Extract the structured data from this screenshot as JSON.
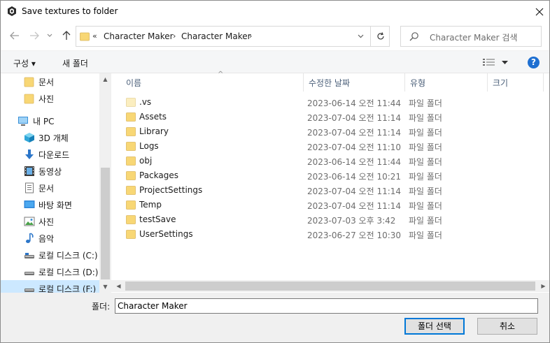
{
  "window": {
    "title": "Save textures to folder",
    "close_label": "✕"
  },
  "nav": {
    "back_label": "←",
    "forward_label": "→",
    "recent_label": "⌄",
    "up_label": "↑"
  },
  "address": {
    "overflow": "«",
    "parts": [
      "Character Maker",
      "Character Maker"
    ],
    "separator": "›"
  },
  "search": {
    "placeholder": "Character Maker 검색"
  },
  "toolbar": {
    "organize_label": "구성 ▾",
    "new_folder_label": "새 폴더",
    "help_label": "?"
  },
  "sidebar": {
    "items": [
      {
        "label": "문서",
        "icon": "folder-icon"
      },
      {
        "label": "사진",
        "icon": "folder-icon"
      },
      {
        "label": "내 PC",
        "icon": "computer-icon"
      },
      {
        "label": "3D 개체",
        "icon": "cube-icon"
      },
      {
        "label": "다운로드",
        "icon": "download-icon"
      },
      {
        "label": "동영상",
        "icon": "video-icon"
      },
      {
        "label": "문서",
        "icon": "document-icon"
      },
      {
        "label": "바탕 화면",
        "icon": "desktop-icon"
      },
      {
        "label": "사진",
        "icon": "pictures-icon"
      },
      {
        "label": "음악",
        "icon": "music-icon"
      },
      {
        "label": "로컬 디스크 (C:)",
        "icon": "drive-icon"
      },
      {
        "label": "로컬 디스크 (D:)",
        "icon": "drive-icon"
      },
      {
        "label": "로컬 디스크 (F:)",
        "icon": "drive-icon"
      }
    ]
  },
  "columns": {
    "name": "이름",
    "date": "수정한 날짜",
    "type": "유형",
    "size": "크기"
  },
  "files": [
    {
      "name": ".vs",
      "date": "2023-06-14 오전 11:44",
      "type": "파일 폴더",
      "hidden": true
    },
    {
      "name": "Assets",
      "date": "2023-07-04 오전 11:14",
      "type": "파일 폴더"
    },
    {
      "name": "Library",
      "date": "2023-07-04 오전 11:14",
      "type": "파일 폴더"
    },
    {
      "name": "Logs",
      "date": "2023-07-04 오전 11:10",
      "type": "파일 폴더"
    },
    {
      "name": "obj",
      "date": "2023-06-14 오전 11:44",
      "type": "파일 폴더"
    },
    {
      "name": "Packages",
      "date": "2023-06-14 오전 10:21",
      "type": "파일 폴더"
    },
    {
      "name": "ProjectSettings",
      "date": "2023-07-04 오전 11:14",
      "type": "파일 폴더"
    },
    {
      "name": "Temp",
      "date": "2023-07-04 오전 11:14",
      "type": "파일 폴더"
    },
    {
      "name": "testSave",
      "date": "2023-07-03 오후 3:42",
      "type": "파일 폴더"
    },
    {
      "name": "UserSettings",
      "date": "2023-06-27 오전 10:30",
      "type": "파일 폴더"
    }
  ],
  "footer": {
    "folder_label": "폴더:",
    "folder_value": "Character Maker",
    "select_label": "폴더 선택",
    "cancel_label": "취소"
  },
  "colors": {
    "folder": "#f8d775",
    "accent": "#0078d7",
    "selection": "#cce8ff"
  }
}
